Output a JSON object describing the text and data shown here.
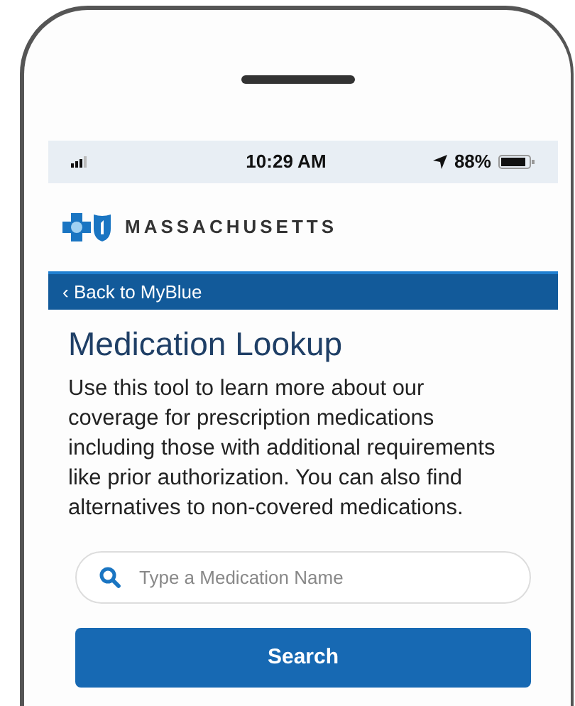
{
  "status_bar": {
    "time": "10:29 AM",
    "battery": "88%"
  },
  "brand": {
    "name": "MASSACHUSETTS"
  },
  "nav": {
    "back_link": "Back to MyBlue",
    "back_glyph": "‹"
  },
  "page": {
    "title": "Medication Lookup",
    "description": "Use this tool to learn more about our coverage for prescription medications including those with additional requirements like prior authorization. You can also find alternatives to non-covered medications."
  },
  "search": {
    "placeholder": "Type a Medication Name"
  },
  "buttons": [
    "Search"
  ]
}
